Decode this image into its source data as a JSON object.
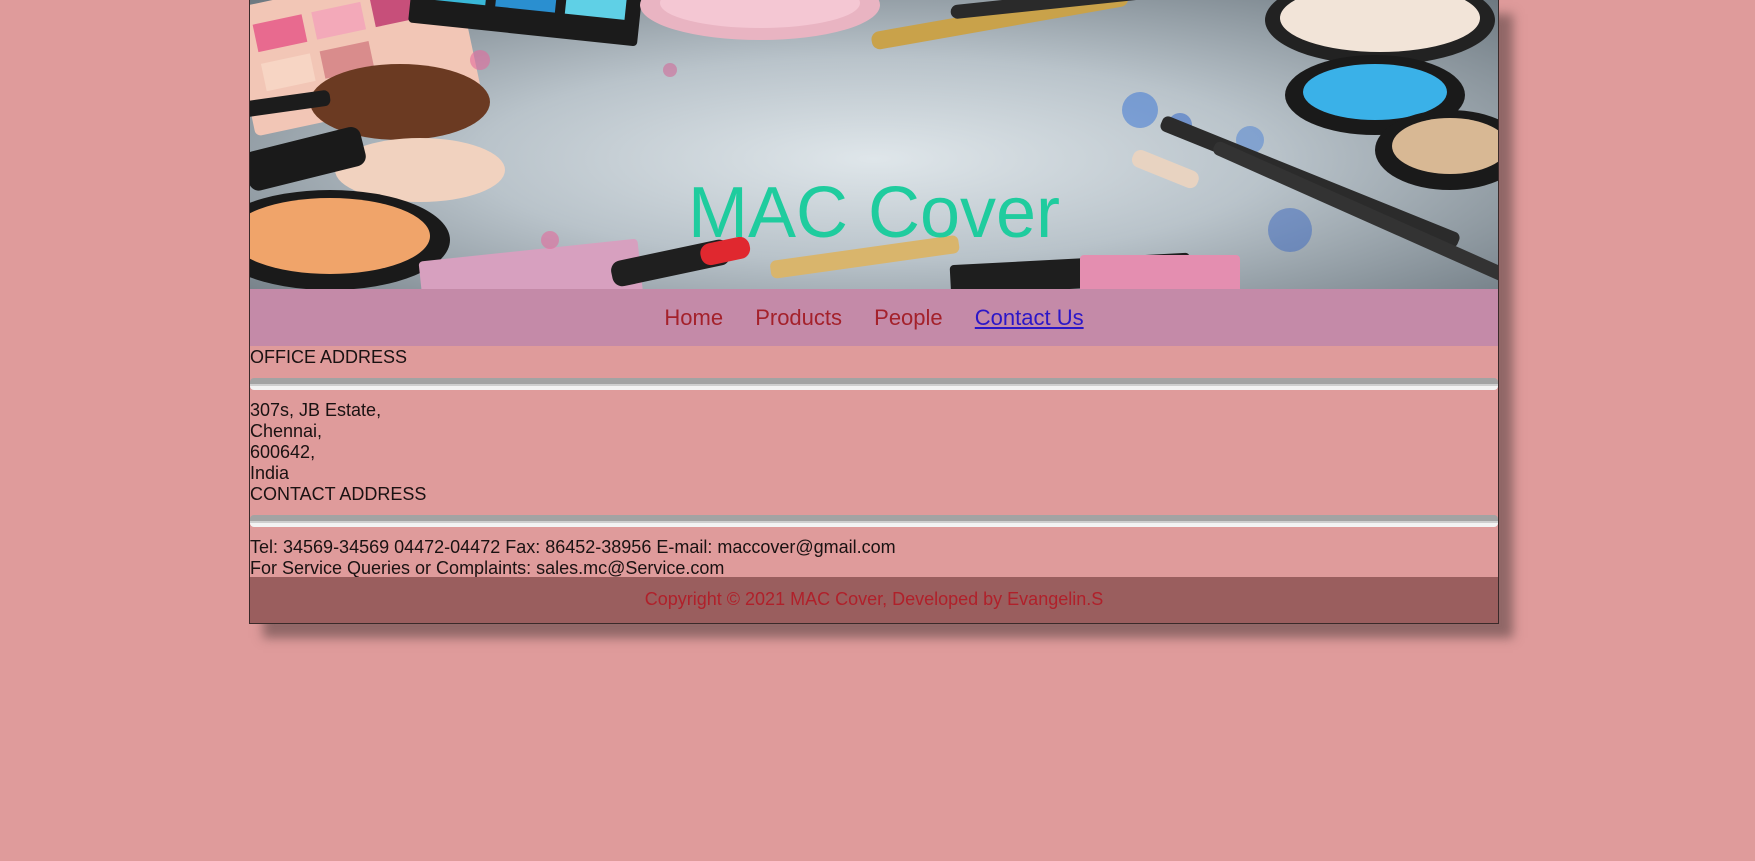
{
  "banner": {
    "title": "MAC Cover"
  },
  "nav": {
    "items": [
      {
        "label": "Home"
      },
      {
        "label": "Products"
      },
      {
        "label": "People"
      },
      {
        "label": "Contact Us"
      }
    ],
    "active": "Contact Us"
  },
  "office": {
    "heading": "OFFICE ADDRESS",
    "lines": [
      "307s, JB Estate,",
      "Chennai,",
      "600642,",
      "India"
    ]
  },
  "contact": {
    "heading": "CONTACT ADDRESS",
    "phone_line": "Tel: 34569-34569 04472-04472 Fax: 86452-38956 E-mail: maccover@gmail.com",
    "service_line": "For Service Queries or Complaints: sales.mc@Service.com"
  },
  "footer": {
    "text": "Copyright © 2021 MAC Cover, Developed by Evangelin.S"
  },
  "colors": {
    "background": "#df9b9b",
    "nav_bg": "#c48aa8",
    "nav_link": "#a4212b",
    "nav_active": "#2b16c8",
    "title": "#1fcc9e",
    "footer_bg": "#9a5e5e",
    "footer_text": "#b0202a"
  }
}
